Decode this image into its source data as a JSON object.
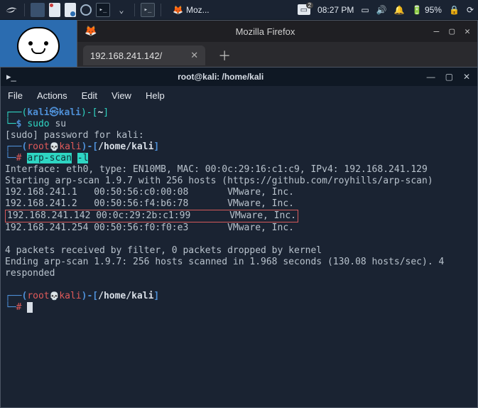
{
  "taskbar": {
    "tasks": [
      {
        "icon": "firefox",
        "label": "Moz..."
      }
    ],
    "workspaces_badge": "2",
    "clock": "08:27 PM",
    "battery": "95%"
  },
  "firefox": {
    "title": "Mozilla Firefox",
    "tabs": [
      {
        "label": "192.168.241.142/"
      }
    ]
  },
  "terminal": {
    "title": "root@kali: /home/kali",
    "menu": [
      "File",
      "Actions",
      "Edit",
      "View",
      "Help"
    ],
    "prompt1_user": "kali",
    "prompt1_at": "㉿",
    "prompt1_host": "kali",
    "prompt1_cwd": "~",
    "cmd1_sudo": "sudo",
    "cmd1_rest": " su",
    "line_pw": "[sudo] password for kali:",
    "prompt2_user": "root",
    "prompt2_host": "kali",
    "prompt2_cwd": "/home/kali",
    "cmd2_a": "arp-scan",
    "cmd2_b": "-l",
    "out": {
      "l1": "Interface: eth0, type: EN10MB, MAC: 00:0c:29:16:c1:c9, IPv4: 192.168.241.129",
      "l2": "Starting arp-scan 1.9.7 with 256 hosts (https://github.com/royhills/arp-scan)",
      "r1": "192.168.241.1   00:50:56:c0:00:08       VMware, Inc.",
      "r2": "192.168.241.2   00:50:56:f4:b6:78       VMware, Inc.",
      "r3": "192.168.241.142 00:0c:29:2b:c1:99       VMware, Inc.",
      "r4": "192.168.241.254 00:50:56:f0:f0:e3       VMware, Inc.",
      "l3": "4 packets received by filter, 0 packets dropped by kernel",
      "l4": "Ending arp-scan 1.9.7: 256 hosts scanned in 1.968 seconds (130.08 hosts/sec). 4 responded"
    }
  }
}
